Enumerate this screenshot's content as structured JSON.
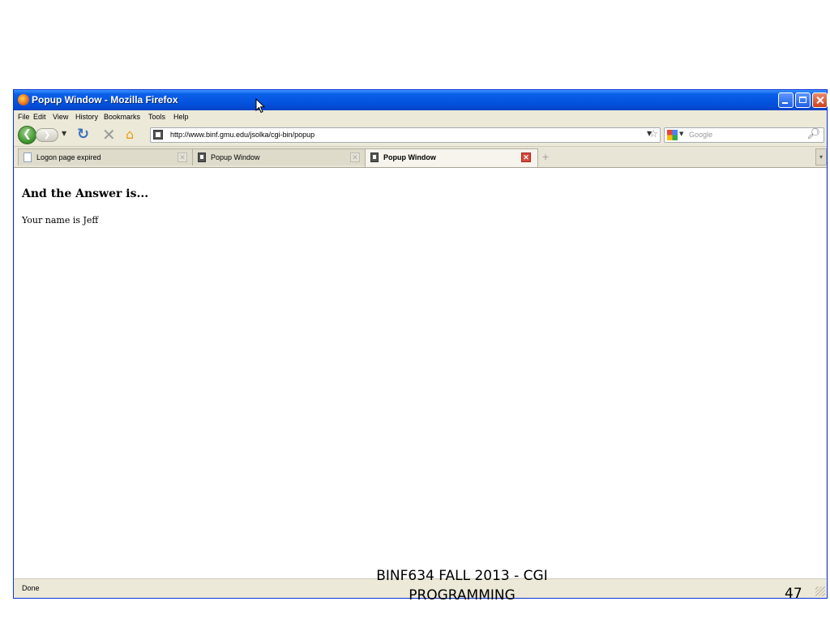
{
  "window": {
    "title": "Popup Window - Mozilla Firefox"
  },
  "menu": [
    "File",
    "Edit",
    "View",
    "History",
    "Bookmarks",
    "Tools",
    "Help"
  ],
  "toolbar": {
    "url": "http://www.binf.gmu.edu/jsolka/cgi-bin/popup",
    "search_placeholder": "Google"
  },
  "tabs": [
    {
      "label": "Logon page expired",
      "active": false
    },
    {
      "label": "Popup Window",
      "active": false
    },
    {
      "label": "Popup Window",
      "active": true
    }
  ],
  "page": {
    "heading": "And the Answer is...",
    "text": "Your name is Jeff"
  },
  "status": {
    "text": "Done"
  },
  "slide": {
    "footer": "BINF634 FALL 2013 - CGI PROGRAMMING",
    "page_number": "47"
  },
  "colors": {
    "titlebar": "#0454e0",
    "chrome": "#ece9d8",
    "close_tab": "#d9463a"
  }
}
